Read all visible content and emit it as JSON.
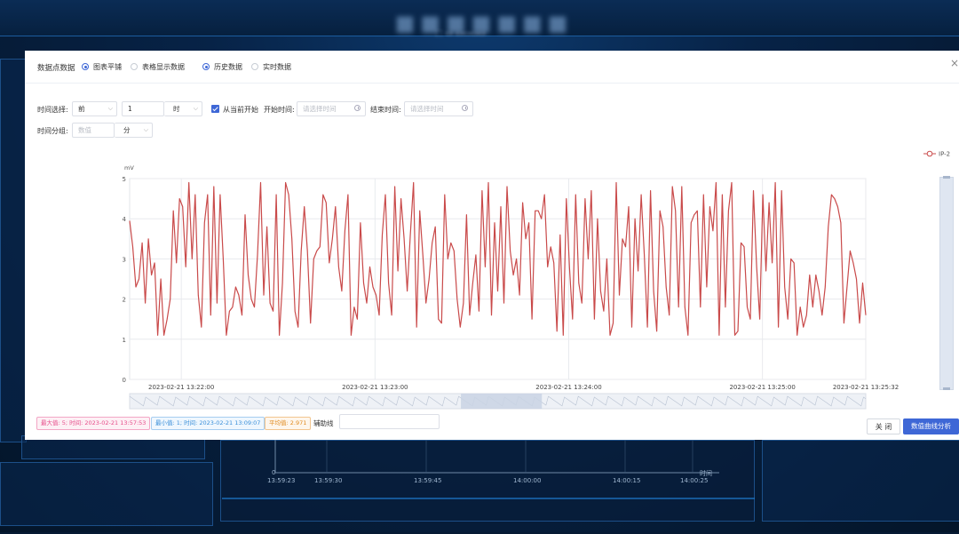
{
  "header": {
    "section_label": "数据点数据",
    "view_options": [
      {
        "label": "图表平铺",
        "selected": true
      },
      {
        "label": "表格显示数据",
        "selected": false
      }
    ],
    "data_options": [
      {
        "label": "历史数据",
        "selected": true
      },
      {
        "label": "实时数据",
        "selected": false
      }
    ],
    "close_icon": "×"
  },
  "filters": {
    "time_select_label": "时间选择:",
    "direction_value": "前",
    "amount_value": "1",
    "unit_value": "时",
    "from_now_label": "从当前开始",
    "from_now_checked": true,
    "start_label": "开始时间:",
    "start_placeholder": "请选择时间",
    "end_label": "结束时间:",
    "end_placeholder": "请选择时间",
    "group_label": "时间分组:",
    "group_placeholder": "数值",
    "group_unit_value": "分"
  },
  "chart_data": {
    "type": "line",
    "ylabel": "mV",
    "ylim": [
      0,
      5
    ],
    "yticks": [
      "0",
      "1",
      "2",
      "3",
      "4",
      "5"
    ],
    "xlim": [
      "2023-02-21 13:21:44",
      "2023-02-21 13:25:32"
    ],
    "xticks": [
      {
        "label": "2023-02-21 13:22:00",
        "t": 16
      },
      {
        "label": "2023-02-21 13:23:00",
        "t": 76
      },
      {
        "label": "2023-02-21 13:24:00",
        "t": 136
      },
      {
        "label": "2023-02-21 13:25:00",
        "t": 196
      },
      {
        "label": "2023-02-21 13:25:32",
        "t": 228
      }
    ],
    "series": [
      {
        "name": "IP-2",
        "color": "#c94a4a",
        "values": [
          3.95,
          3.3,
          2.3,
          2.5,
          3.4,
          1.9,
          3.5,
          2.6,
          2.9,
          1.1,
          2.5,
          1.1,
          1.5,
          2.0,
          4.2,
          2.9,
          4.5,
          4.3,
          2.8,
          4.9,
          3.0,
          4.6,
          2.1,
          1.3,
          3.9,
          4.6,
          1.6,
          4.8,
          1.9,
          4.6,
          3.0,
          1.1,
          1.7,
          1.8,
          2.3,
          2.1,
          1.6,
          4.1,
          2.6,
          2.0,
          1.8,
          3.1,
          4.9,
          2.1,
          3.8,
          1.9,
          1.7,
          4.6,
          1.1,
          2.4,
          4.9,
          4.6,
          3.5,
          1.7,
          1.3,
          3.2,
          4.3,
          3.2,
          1.4,
          3.0,
          3.2,
          3.3,
          4.6,
          4.4,
          2.9,
          3.5,
          4.3,
          2.8,
          2.2,
          3.7,
          4.6,
          1.1,
          1.8,
          1.5,
          3.9,
          2.4,
          1.9,
          2.8,
          2.3,
          2.1,
          1.6,
          3.6,
          4.6,
          2.4,
          1.6,
          4.8,
          2.7,
          4.5,
          3.5,
          2.2,
          3.6,
          4.9,
          1.3,
          4.2,
          3.1,
          1.9,
          2.5,
          3.4,
          3.8,
          1.5,
          1.4,
          4.6,
          3.0,
          3.4,
          3.2,
          2.0,
          1.3,
          1.9,
          4.1,
          1.6,
          2.4,
          3.1,
          1.7,
          4.7,
          2.8,
          4.9,
          1.6,
          3.9,
          2.2,
          4.3,
          1.9,
          4.8,
          3.2,
          2.6,
          3.0,
          2.1,
          4.4,
          3.5,
          3.9,
          1.5,
          4.2,
          4.2,
          4.0,
          4.6,
          2.8,
          3.3,
          2.9,
          1.2,
          3.6,
          1.1,
          4.5,
          2.8,
          1.5,
          4.6,
          2.4,
          1.9,
          4.5,
          3.0,
          4.7,
          1.5,
          4.0,
          2.2,
          1.7,
          3.0,
          1.1,
          1.4,
          4.9,
          2.1,
          3.5,
          3.3,
          4.3,
          1.3,
          4.0,
          2.7,
          4.6,
          3.1,
          1.3,
          4.7,
          2.2,
          1.2,
          4.2,
          3.8,
          2.3,
          1.6,
          4.8,
          4.2,
          1.8,
          4.8,
          1.8,
          1.1,
          3.9,
          4.1,
          4.2,
          1.8,
          4.6,
          2.3,
          4.3,
          3.7,
          4.9,
          1.1,
          4.6,
          1.8,
          4.2,
          4.9,
          1.1,
          1.2,
          3.4,
          3.3,
          1.8,
          1.5,
          4.7,
          2.8,
          1.5,
          4.6,
          2.7,
          4.4,
          2.9,
          4.9,
          1.3,
          4.7,
          2.3,
          1.5,
          3.0,
          2.9,
          1.1,
          1.8,
          1.3,
          1.6,
          2.6,
          1.8,
          2.6,
          2.2,
          1.6,
          2.3,
          3.8,
          4.6,
          4.5,
          4.3,
          3.9,
          1.4,
          2.3,
          3.2,
          2.9,
          2.5,
          1.4,
          2.4,
          1.6
        ]
      }
    ],
    "legend": "top-right",
    "grid": true,
    "slider_range": [
      0.45,
      0.56
    ]
  },
  "footer": {
    "max_badge": "最大值: 5; 时间: 2023-02-21 13:57:53",
    "min_badge": "最小值: 1; 时间: 2023-02-21 13:09:07",
    "avg_badge": "平均值: 2.971",
    "aux_line_label": "辅助线",
    "aux_line_value": "",
    "close_button": "关 闭",
    "analyze_button": "数值曲线分析"
  },
  "background": {
    "time_ticks": [
      "13:59:23",
      "13:59:30",
      "13:59:45",
      "14:00:00",
      "14:00:15",
      "14:00:25"
    ],
    "axis_zero": "0",
    "axis_unit": "时间"
  },
  "colors": {
    "accent": "#3e67d6",
    "series": "#c94a4a",
    "max": "#e64d8a",
    "min": "#3a8fd9",
    "avg": "#e08a1e"
  }
}
